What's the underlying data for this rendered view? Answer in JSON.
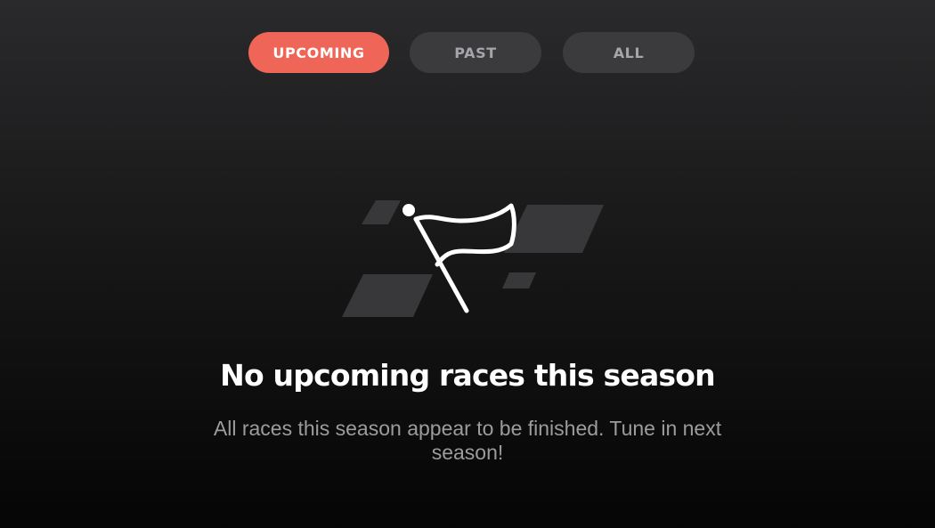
{
  "filters": {
    "upcoming_label": "UPCOMING",
    "past_label": "PAST",
    "all_label": "ALL",
    "active": "UPCOMING"
  },
  "empty_state": {
    "icon": "checkered-flag-icon",
    "title": "No upcoming races this season",
    "message": "All races this season appear to be finished. Tune in next season!"
  },
  "colors": {
    "accent": "#ef6557",
    "inactive_pill": "#3b3b3e",
    "background": "#1c1c1d"
  }
}
